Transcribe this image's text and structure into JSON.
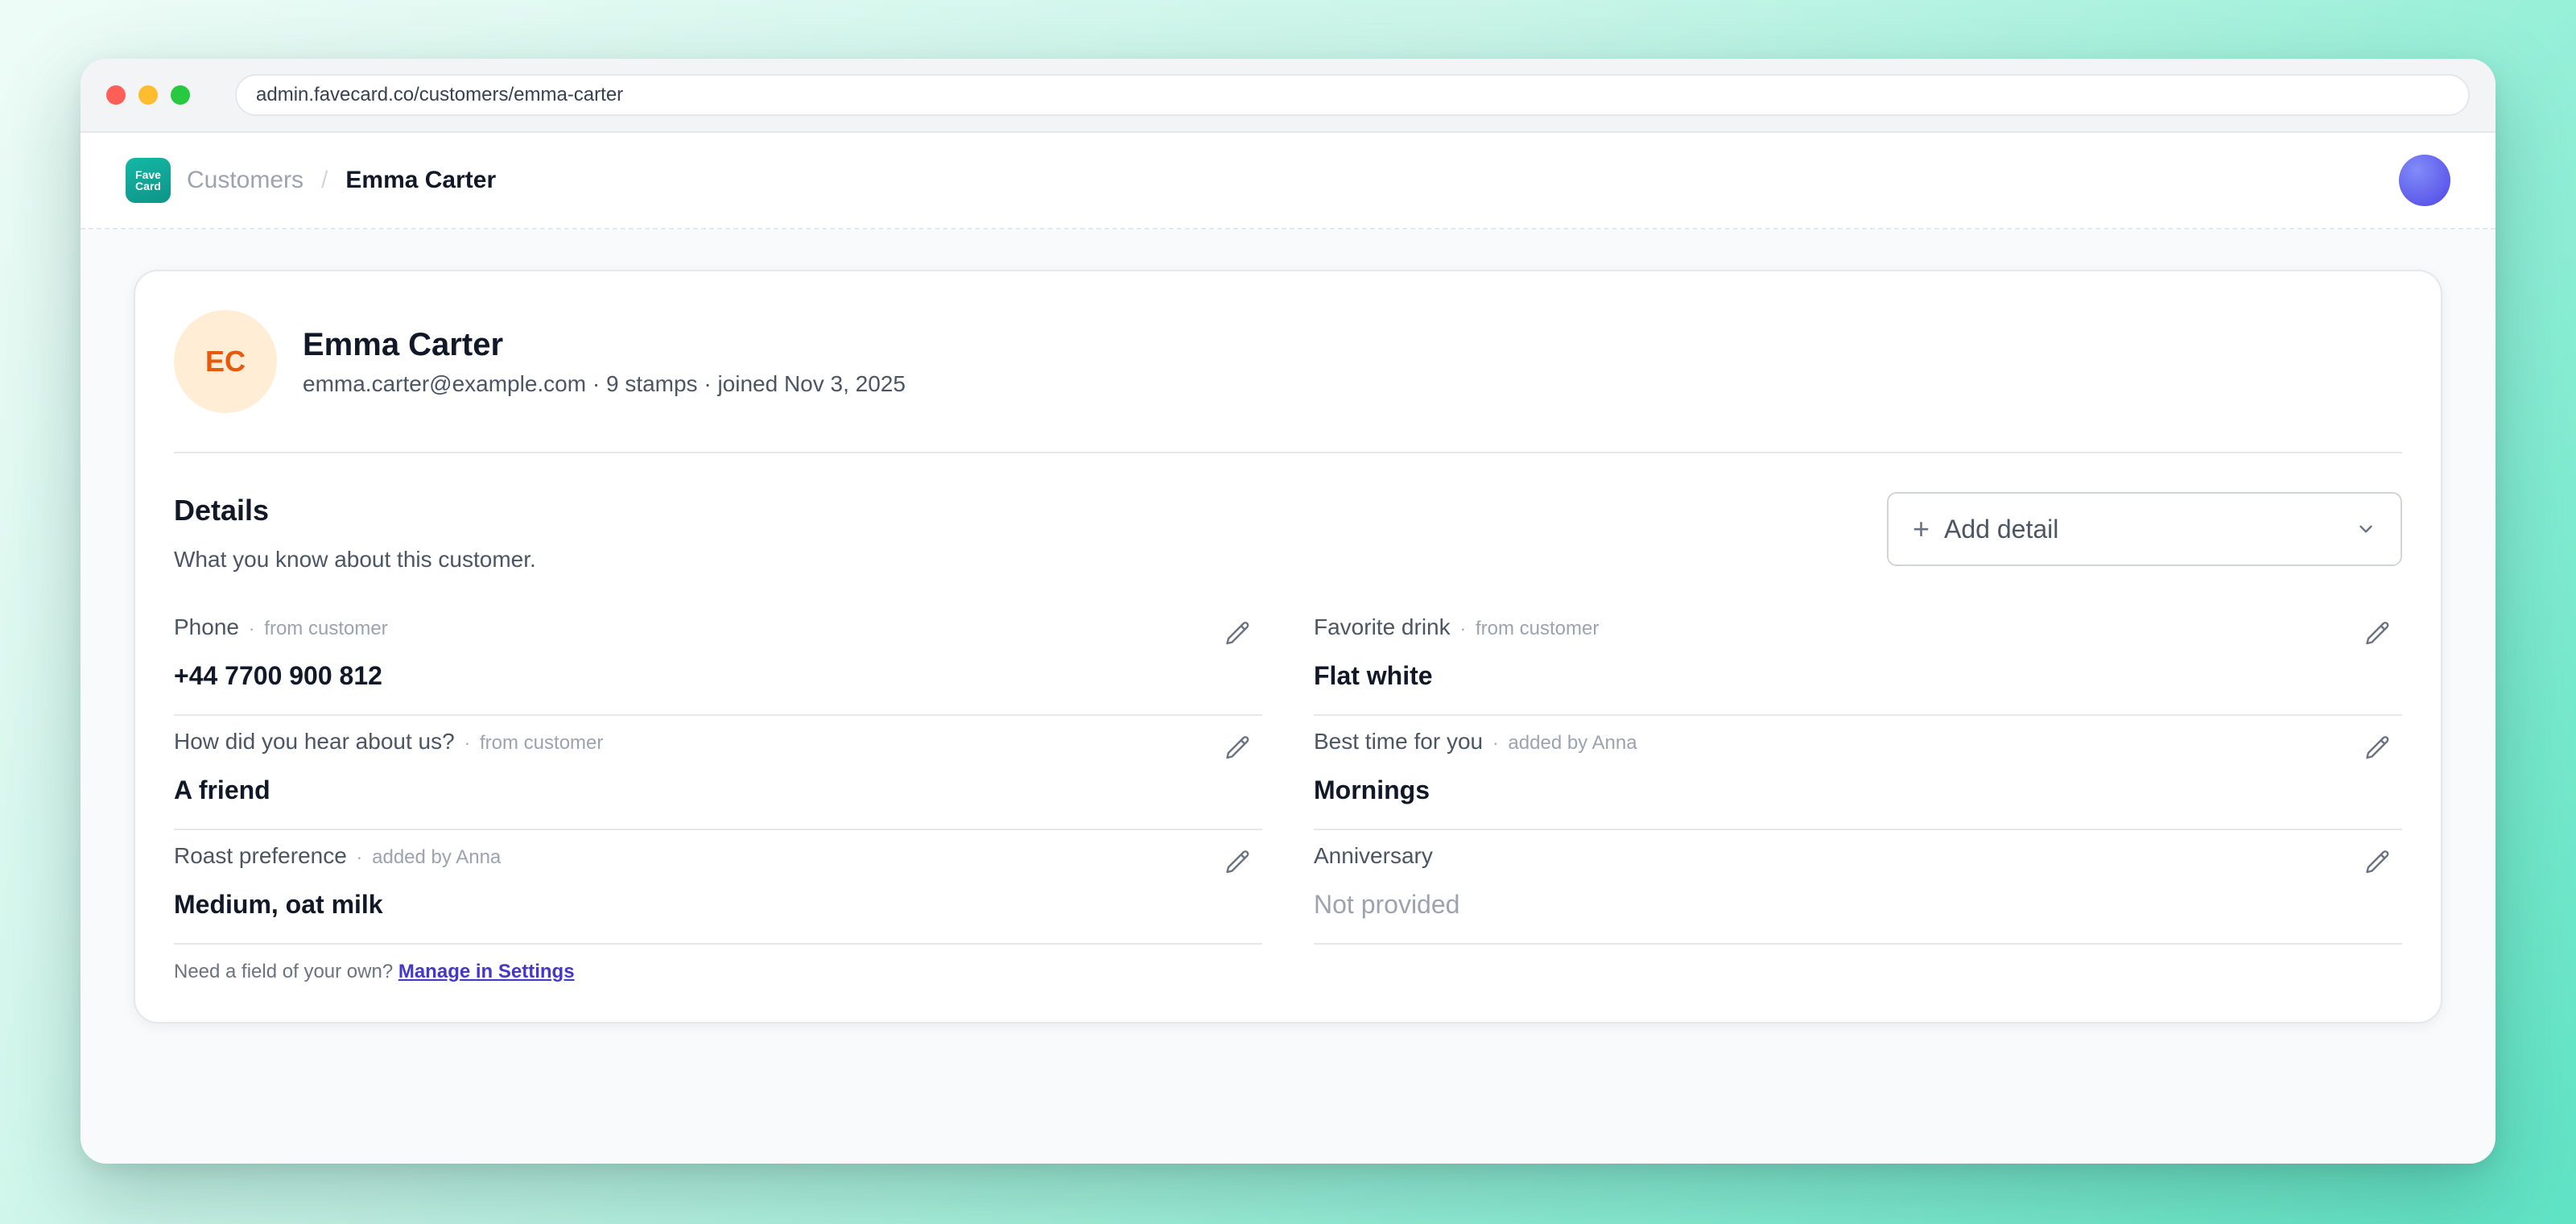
{
  "browser": {
    "url": "admin.favecard.co/customers/emma-carter"
  },
  "header": {
    "logo_line1": "Fave",
    "logo_line2": "Card",
    "breadcrumb_parent": "Customers",
    "breadcrumb_separator": "/",
    "breadcrumb_current": "Emma Carter"
  },
  "profile": {
    "initials": "EC",
    "name": "Emma Carter",
    "meta": "emma.carter@example.com · 9 stamps · joined Nov 3, 2025"
  },
  "details": {
    "title": "Details",
    "subtitle": "What you know about this customer.",
    "add_button_label": "Add detail",
    "fields": [
      {
        "label": "Phone",
        "source": "from customer",
        "value": "+44 7700 900 812",
        "empty": false
      },
      {
        "label": "Favorite drink",
        "source": "from customer",
        "value": "Flat white",
        "empty": false
      },
      {
        "label": "How did you hear about us?",
        "source": "from customer",
        "value": "A friend",
        "empty": false
      },
      {
        "label": "Best time for you",
        "source": "added by Anna",
        "value": "Mornings",
        "empty": false
      },
      {
        "label": "Roast preference",
        "source": "added by Anna",
        "value": "Medium, oat milk",
        "empty": false
      },
      {
        "label": "Anniversary",
        "source": "",
        "value": "Not provided",
        "empty": true
      }
    ],
    "footer_text": "Need a field of your own?",
    "footer_link": "Manage in Settings"
  },
  "colors": {
    "brand": "#14b8a6",
    "avatar_bg": "#ffedd5",
    "avatar_text": "#ea580c",
    "link": "#4338ca"
  },
  "icons": {
    "edit": "pencil-icon",
    "add": "plus-icon",
    "dropdown": "chevron-down-icon"
  }
}
